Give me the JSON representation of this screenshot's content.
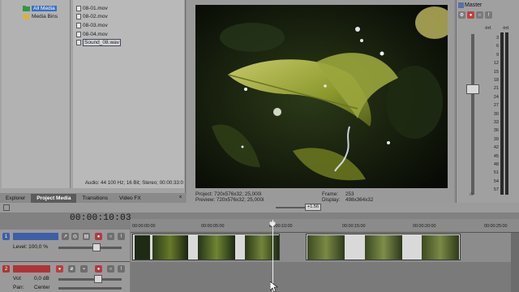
{
  "media_tree": {
    "items": [
      {
        "label": "All Media",
        "selected": true
      },
      {
        "label": "Media Bins",
        "selected": false
      }
    ]
  },
  "media_files": {
    "items": [
      {
        "label": "08-01.mov"
      },
      {
        "label": "08-02.mov"
      },
      {
        "label": "08-03.mov"
      },
      {
        "label": "08-04.mov"
      },
      {
        "label": "Sound_08.wav"
      }
    ]
  },
  "media_status": "Audio: 44 100 Hz; 16 Bit; Stereo; 00:00:33:0",
  "tabs": [
    {
      "label": "Explorer",
      "active": false
    },
    {
      "label": "Project Media",
      "active": true
    },
    {
      "label": "Transitions",
      "active": false
    },
    {
      "label": "Video FX",
      "active": false
    }
  ],
  "preview": {
    "project": "Project:  720x576x32; 25,000i",
    "preview_label": "Preview: 720x576x32; 25,000i",
    "frame": "Frame:",
    "frame_value": "253",
    "display": "Display:",
    "display_value": "498x364x32"
  },
  "master": {
    "title": "Master",
    "scale": [
      "3",
      "6",
      "9",
      "12",
      "15",
      "18",
      "21",
      "24",
      "27",
      "30",
      "33",
      "36",
      "39",
      "42",
      "45",
      "48",
      "51",
      "54",
      "57"
    ],
    "peak_left": "-Inf.",
    "peak_right": "-Inf."
  },
  "timeline": {
    "timecode": "00:00:10:03",
    "rate": "+1.56",
    "ruler": [
      "00:00:00:00",
      "00:00:05:00",
      "00:00:10:00",
      "00:00:15:00",
      "00:00:20:00",
      "00:00:25:00"
    ],
    "video_track": {
      "number": "1",
      "level_label": "Level: 100,0 %"
    },
    "audio_track": {
      "number": "2",
      "vol_label": "Vol:",
      "vol_value": "0,0 dB",
      "pan_label": "Pan:",
      "pan_value": "Center"
    }
  },
  "colors": {
    "selection": "#3c6fc4",
    "track_video": "#3b5fa8",
    "track_audio": "#b03434",
    "cursor": "#ffffff"
  }
}
